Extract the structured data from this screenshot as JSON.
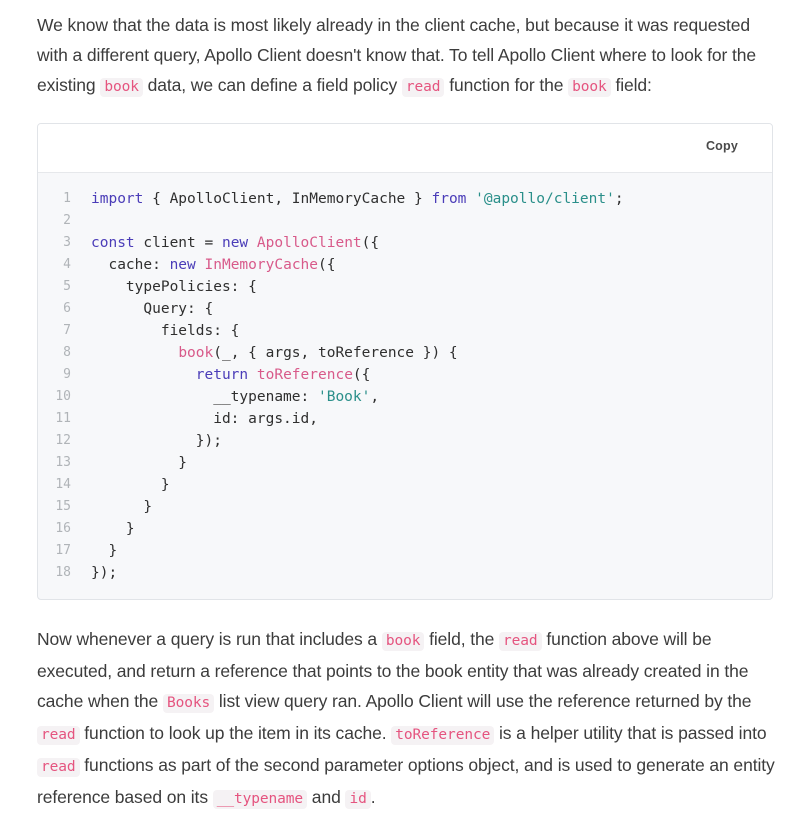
{
  "paragraph_1": [
    {
      "t": "We know that the data is most likely already in the client cache, but because it was requested with a different query, Apollo Client doesn't know that. To tell Apollo Client where to look for the existing "
    },
    {
      "c": "book"
    },
    {
      "t": " data, we can define a field policy "
    },
    {
      "c": "read"
    },
    {
      "t": " function for the "
    },
    {
      "c": "book"
    },
    {
      "t": " field:"
    }
  ],
  "code_block": {
    "copy_label": "Copy",
    "lines": [
      {
        "n": "1",
        "tokens": [
          [
            "kw",
            "import"
          ],
          [
            "plain",
            " { ApolloClient, InMemoryCache } "
          ],
          [
            "kw",
            "from"
          ],
          [
            "plain",
            " "
          ],
          [
            "str",
            "'@apollo/client'"
          ],
          [
            "plain",
            ";"
          ]
        ]
      },
      {
        "n": "2",
        "tokens": []
      },
      {
        "n": "3",
        "tokens": [
          [
            "kw",
            "const"
          ],
          [
            "plain",
            " client = "
          ],
          [
            "kw",
            "new"
          ],
          [
            "plain",
            " "
          ],
          [
            "fn",
            "ApolloClient"
          ],
          [
            "plain",
            "({"
          ]
        ]
      },
      {
        "n": "4",
        "tokens": [
          [
            "plain",
            "  cache: "
          ],
          [
            "kw",
            "new"
          ],
          [
            "plain",
            " "
          ],
          [
            "fn",
            "InMemoryCache"
          ],
          [
            "plain",
            "({"
          ]
        ]
      },
      {
        "n": "5",
        "tokens": [
          [
            "plain",
            "    typePolicies: {"
          ]
        ]
      },
      {
        "n": "6",
        "tokens": [
          [
            "plain",
            "      Query: {"
          ]
        ]
      },
      {
        "n": "7",
        "tokens": [
          [
            "plain",
            "        fields: {"
          ]
        ]
      },
      {
        "n": "8",
        "tokens": [
          [
            "plain",
            "          "
          ],
          [
            "fn",
            "book"
          ],
          [
            "plain",
            "(_, { args, toReference }) {"
          ]
        ]
      },
      {
        "n": "9",
        "tokens": [
          [
            "plain",
            "            "
          ],
          [
            "kw",
            "return"
          ],
          [
            "plain",
            " "
          ],
          [
            "fn",
            "toReference"
          ],
          [
            "plain",
            "({"
          ]
        ]
      },
      {
        "n": "10",
        "tokens": [
          [
            "plain",
            "              __typename: "
          ],
          [
            "str",
            "'Book'"
          ],
          [
            "plain",
            ","
          ]
        ]
      },
      {
        "n": "11",
        "tokens": [
          [
            "plain",
            "              id: args.id,"
          ]
        ]
      },
      {
        "n": "12",
        "tokens": [
          [
            "plain",
            "            });"
          ]
        ]
      },
      {
        "n": "13",
        "tokens": [
          [
            "plain",
            "          }"
          ]
        ]
      },
      {
        "n": "14",
        "tokens": [
          [
            "plain",
            "        }"
          ]
        ]
      },
      {
        "n": "15",
        "tokens": [
          [
            "plain",
            "      }"
          ]
        ]
      },
      {
        "n": "16",
        "tokens": [
          [
            "plain",
            "    }"
          ]
        ]
      },
      {
        "n": "17",
        "tokens": [
          [
            "plain",
            "  }"
          ]
        ]
      },
      {
        "n": "18",
        "tokens": [
          [
            "plain",
            "});"
          ]
        ]
      }
    ]
  },
  "paragraph_2": [
    {
      "t": "Now whenever a query is run that includes a "
    },
    {
      "c": "book"
    },
    {
      "t": " field, the "
    },
    {
      "c": "read"
    },
    {
      "t": " function above will be executed, and return a reference that points to the book entity that was already created in the cache when the "
    },
    {
      "c": "Books"
    },
    {
      "t": " list view query ran. Apollo Client will use the reference returned by the "
    },
    {
      "c": "read"
    },
    {
      "t": " function to look up the item in its cache. "
    },
    {
      "c": "toReference"
    },
    {
      "t": " is a helper utility that is passed into "
    },
    {
      "c": "read"
    },
    {
      "t": " functions as part of the second parameter options object, and is used to generate an entity reference based on its "
    },
    {
      "c": "__typename"
    },
    {
      "t": " and "
    },
    {
      "c": "id"
    },
    {
      "t": "."
    }
  ]
}
